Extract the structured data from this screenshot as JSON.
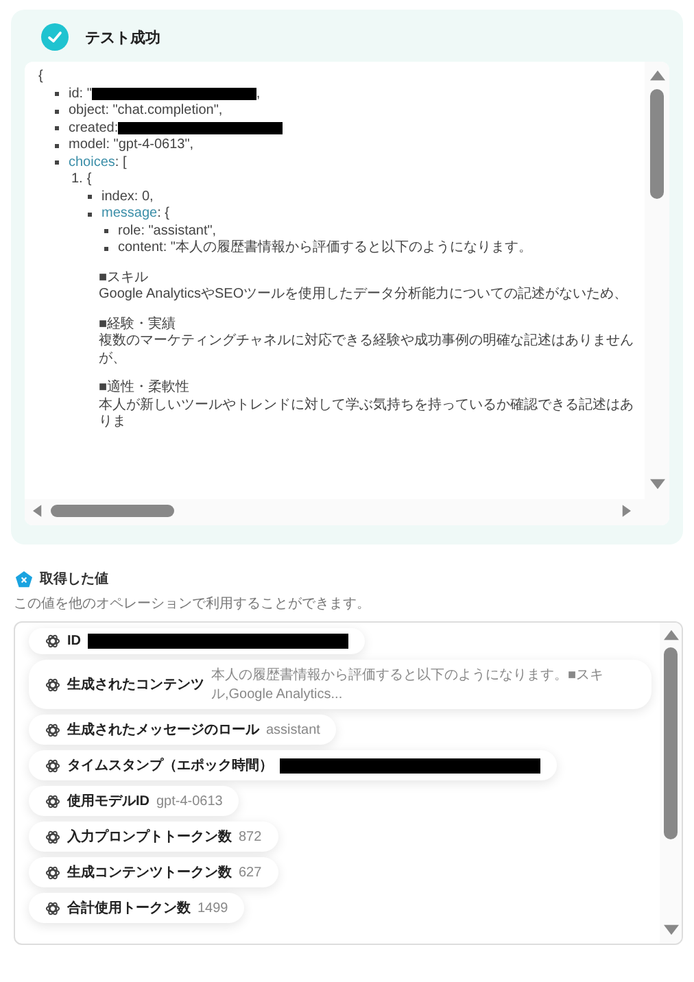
{
  "result": {
    "title": "テスト成功",
    "success": true,
    "response": {
      "open": "{",
      "children": [
        {
          "kind": "bullet",
          "key": "id",
          "value": ": \"",
          "redacted": true,
          "tail": ","
        },
        {
          "kind": "bullet",
          "key": "object",
          "value": ": \"chat.completion\","
        },
        {
          "kind": "bullet",
          "key": "created",
          "value": ":",
          "redacted": true
        },
        {
          "kind": "bullet",
          "key": "model",
          "value": ": \"gpt-4-0613\","
        },
        {
          "kind": "bullet",
          "key": "choices",
          "link": true,
          "value": ": [",
          "children": [
            {
              "kind": "numbered",
              "number": "1.",
              "value": "{",
              "children": [
                {
                  "kind": "bullet",
                  "key": "index",
                  "value": ": 0,"
                },
                {
                  "kind": "bullet",
                  "key": "message",
                  "link": true,
                  "value": ": {",
                  "children": [
                    {
                      "kind": "bullet",
                      "key": "role",
                      "value": ": \"assistant\","
                    },
                    {
                      "kind": "bullet",
                      "key": "content",
                      "value": ": \"本人の履歴書情報から評価すると以下のようになります。",
                      "children": [
                        {
                          "kind": "paragraph",
                          "lines": [
                            "■スキル",
                            "Google AnalyticsやSEOツールを使用したデータ分析能力についての記述がないため、"
                          ]
                        },
                        {
                          "kind": "paragraph",
                          "lines": [
                            "■経験・実績",
                            "複数のマーケティングチャネルに対応できる経験や成功事例の明確な記述はありませんが、"
                          ]
                        },
                        {
                          "kind": "paragraph",
                          "lines": [
                            "■適性・柔軟性",
                            "本人が新しいツールやトレンドに対して学ぶ気持ちを持っているか確認できる記述はありま"
                          ]
                        }
                      ]
                    }
                  ]
                }
              ]
            }
          ]
        }
      ]
    }
  },
  "values": {
    "title": "取得した値",
    "description": "この値を他のオペレーションで利用することができます。",
    "items": [
      {
        "label": "ID",
        "redacted": true
      },
      {
        "label": "生成されたコンテンツ",
        "value": "本人の履歴書情報から評価すると以下のようになります。■スキル,Google Analytics..."
      },
      {
        "label": "生成されたメッセージのロール",
        "value": "assistant"
      },
      {
        "label": "タイムスタンプ（エポック時間）",
        "redacted": true
      },
      {
        "label": "使用モデルID",
        "value": "gpt-4-0613"
      },
      {
        "label": "入力プロンプトトークン数",
        "value": "872"
      },
      {
        "label": "生成コンテンツトークン数",
        "value": "627"
      },
      {
        "label": "合計使用トークン数",
        "value": "1499"
      }
    ]
  }
}
